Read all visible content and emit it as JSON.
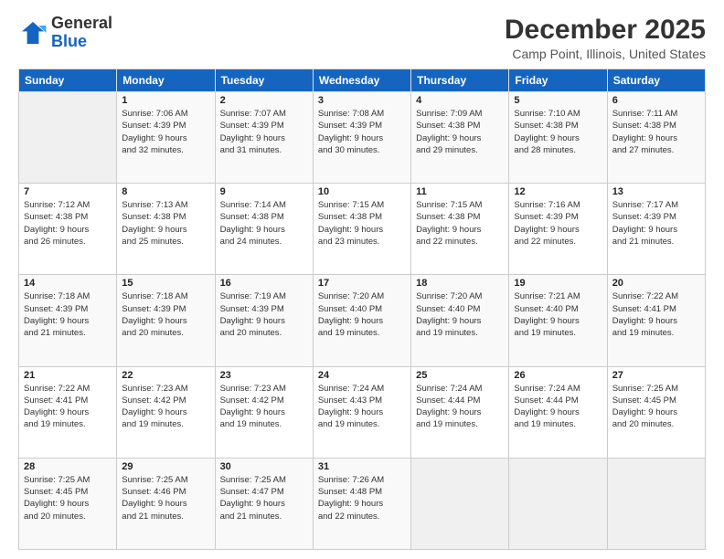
{
  "logo": {
    "line1": "General",
    "line2": "Blue"
  },
  "title": "December 2025",
  "subtitle": "Camp Point, Illinois, United States",
  "days_of_week": [
    "Sunday",
    "Monday",
    "Tuesday",
    "Wednesday",
    "Thursday",
    "Friday",
    "Saturday"
  ],
  "weeks": [
    [
      {
        "day": "",
        "info": ""
      },
      {
        "day": "1",
        "info": "Sunrise: 7:06 AM\nSunset: 4:39 PM\nDaylight: 9 hours\nand 32 minutes."
      },
      {
        "day": "2",
        "info": "Sunrise: 7:07 AM\nSunset: 4:39 PM\nDaylight: 9 hours\nand 31 minutes."
      },
      {
        "day": "3",
        "info": "Sunrise: 7:08 AM\nSunset: 4:39 PM\nDaylight: 9 hours\nand 30 minutes."
      },
      {
        "day": "4",
        "info": "Sunrise: 7:09 AM\nSunset: 4:38 PM\nDaylight: 9 hours\nand 29 minutes."
      },
      {
        "day": "5",
        "info": "Sunrise: 7:10 AM\nSunset: 4:38 PM\nDaylight: 9 hours\nand 28 minutes."
      },
      {
        "day": "6",
        "info": "Sunrise: 7:11 AM\nSunset: 4:38 PM\nDaylight: 9 hours\nand 27 minutes."
      }
    ],
    [
      {
        "day": "7",
        "info": "Sunrise: 7:12 AM\nSunset: 4:38 PM\nDaylight: 9 hours\nand 26 minutes."
      },
      {
        "day": "8",
        "info": "Sunrise: 7:13 AM\nSunset: 4:38 PM\nDaylight: 9 hours\nand 25 minutes."
      },
      {
        "day": "9",
        "info": "Sunrise: 7:14 AM\nSunset: 4:38 PM\nDaylight: 9 hours\nand 24 minutes."
      },
      {
        "day": "10",
        "info": "Sunrise: 7:15 AM\nSunset: 4:38 PM\nDaylight: 9 hours\nand 23 minutes."
      },
      {
        "day": "11",
        "info": "Sunrise: 7:15 AM\nSunset: 4:38 PM\nDaylight: 9 hours\nand 22 minutes."
      },
      {
        "day": "12",
        "info": "Sunrise: 7:16 AM\nSunset: 4:39 PM\nDaylight: 9 hours\nand 22 minutes."
      },
      {
        "day": "13",
        "info": "Sunrise: 7:17 AM\nSunset: 4:39 PM\nDaylight: 9 hours\nand 21 minutes."
      }
    ],
    [
      {
        "day": "14",
        "info": "Sunrise: 7:18 AM\nSunset: 4:39 PM\nDaylight: 9 hours\nand 21 minutes."
      },
      {
        "day": "15",
        "info": "Sunrise: 7:18 AM\nSunset: 4:39 PM\nDaylight: 9 hours\nand 20 minutes."
      },
      {
        "day": "16",
        "info": "Sunrise: 7:19 AM\nSunset: 4:39 PM\nDaylight: 9 hours\nand 20 minutes."
      },
      {
        "day": "17",
        "info": "Sunrise: 7:20 AM\nSunset: 4:40 PM\nDaylight: 9 hours\nand 19 minutes."
      },
      {
        "day": "18",
        "info": "Sunrise: 7:20 AM\nSunset: 4:40 PM\nDaylight: 9 hours\nand 19 minutes."
      },
      {
        "day": "19",
        "info": "Sunrise: 7:21 AM\nSunset: 4:40 PM\nDaylight: 9 hours\nand 19 minutes."
      },
      {
        "day": "20",
        "info": "Sunrise: 7:22 AM\nSunset: 4:41 PM\nDaylight: 9 hours\nand 19 minutes."
      }
    ],
    [
      {
        "day": "21",
        "info": "Sunrise: 7:22 AM\nSunset: 4:41 PM\nDaylight: 9 hours\nand 19 minutes."
      },
      {
        "day": "22",
        "info": "Sunrise: 7:23 AM\nSunset: 4:42 PM\nDaylight: 9 hours\nand 19 minutes."
      },
      {
        "day": "23",
        "info": "Sunrise: 7:23 AM\nSunset: 4:42 PM\nDaylight: 9 hours\nand 19 minutes."
      },
      {
        "day": "24",
        "info": "Sunrise: 7:24 AM\nSunset: 4:43 PM\nDaylight: 9 hours\nand 19 minutes."
      },
      {
        "day": "25",
        "info": "Sunrise: 7:24 AM\nSunset: 4:44 PM\nDaylight: 9 hours\nand 19 minutes."
      },
      {
        "day": "26",
        "info": "Sunrise: 7:24 AM\nSunset: 4:44 PM\nDaylight: 9 hours\nand 19 minutes."
      },
      {
        "day": "27",
        "info": "Sunrise: 7:25 AM\nSunset: 4:45 PM\nDaylight: 9 hours\nand 20 minutes."
      }
    ],
    [
      {
        "day": "28",
        "info": "Sunrise: 7:25 AM\nSunset: 4:45 PM\nDaylight: 9 hours\nand 20 minutes."
      },
      {
        "day": "29",
        "info": "Sunrise: 7:25 AM\nSunset: 4:46 PM\nDaylight: 9 hours\nand 21 minutes."
      },
      {
        "day": "30",
        "info": "Sunrise: 7:25 AM\nSunset: 4:47 PM\nDaylight: 9 hours\nand 21 minutes."
      },
      {
        "day": "31",
        "info": "Sunrise: 7:26 AM\nSunset: 4:48 PM\nDaylight: 9 hours\nand 22 minutes."
      },
      {
        "day": "",
        "info": ""
      },
      {
        "day": "",
        "info": ""
      },
      {
        "day": "",
        "info": ""
      }
    ]
  ]
}
